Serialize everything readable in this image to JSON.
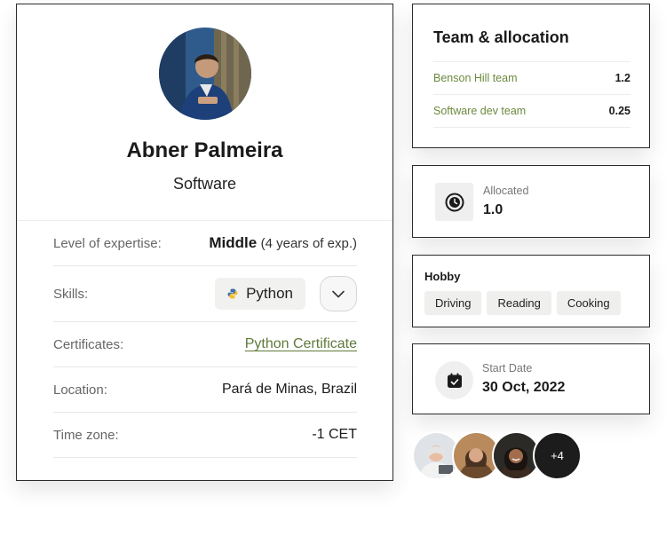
{
  "profile": {
    "name": "Abner Palmeira",
    "role": "Software",
    "expertise_label": "Level of expertise:",
    "expertise_level": "Middle",
    "expertise_years": "(4 years of exp.)",
    "skills_label": "Skills:",
    "skill": "Python",
    "certificates_label": "Certificates:",
    "certificate": "Python Certificate",
    "location_label": "Location:",
    "location": "Pará de Minas, Brazil",
    "timezone_label": "Time zone:",
    "timezone": "-1 CET"
  },
  "team": {
    "title": "Team & allocation",
    "rows": [
      {
        "name": "Benson Hill team",
        "value": "1.2"
      },
      {
        "name": "Software dev team",
        "value": "0.25"
      }
    ]
  },
  "allocated": {
    "label": "Allocated",
    "value": "1.0"
  },
  "hobby": {
    "title": "Hobby",
    "items": [
      "Driving",
      "Reading",
      "Cooking"
    ]
  },
  "start_date": {
    "label": "Start Date",
    "value": "30 Oct, 2022"
  },
  "avatars": {
    "more": "+4"
  },
  "colors": {
    "accent_green": "#5f7a3a",
    "border": "#2b2b2b",
    "chip_bg": "#f1f1ef"
  }
}
